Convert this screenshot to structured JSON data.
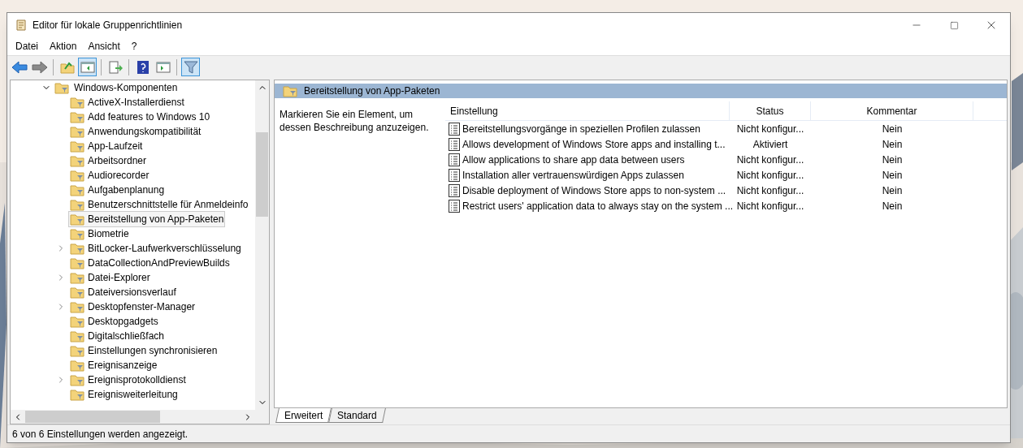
{
  "window": {
    "title": "Editor für lokale Gruppenrichtlinien"
  },
  "menu": [
    "Datei",
    "Aktion",
    "Ansicht",
    "?"
  ],
  "toolbar": [
    {
      "kind": "back",
      "pressed": false
    },
    {
      "kind": "forward",
      "pressed": false
    },
    {
      "kind": "sep"
    },
    {
      "kind": "up",
      "pressed": false
    },
    {
      "kind": "tree",
      "pressed": true
    },
    {
      "kind": "sep"
    },
    {
      "kind": "export",
      "pressed": false
    },
    {
      "kind": "sep"
    },
    {
      "kind": "help",
      "pressed": false
    },
    {
      "kind": "pane",
      "pressed": false
    },
    {
      "kind": "sep"
    },
    {
      "kind": "filter",
      "pressed": true
    }
  ],
  "tree": {
    "label": "Windows-Komponenten",
    "expanded": true,
    "children": [
      {
        "label": "ActiveX-Installerdienst",
        "expandable": false,
        "selected": false
      },
      {
        "label": "Add features to Windows 10",
        "expandable": false,
        "selected": false
      },
      {
        "label": "Anwendungskompatibilität",
        "expandable": false,
        "selected": false
      },
      {
        "label": "App-Laufzeit",
        "expandable": false,
        "selected": false
      },
      {
        "label": "Arbeitsordner",
        "expandable": false,
        "selected": false
      },
      {
        "label": "Audiorecorder",
        "expandable": false,
        "selected": false
      },
      {
        "label": "Aufgabenplanung",
        "expandable": false,
        "selected": false
      },
      {
        "label": "Benutzerschnittstelle für Anmeldeinfo",
        "expandable": false,
        "selected": false
      },
      {
        "label": "Bereitstellung von App-Paketen",
        "expandable": false,
        "selected": true
      },
      {
        "label": "Biometrie",
        "expandable": false,
        "selected": false
      },
      {
        "label": "BitLocker-Laufwerkverschlüsselung",
        "expandable": true,
        "selected": false
      },
      {
        "label": "DataCollectionAndPreviewBuilds",
        "expandable": false,
        "selected": false
      },
      {
        "label": "Datei-Explorer",
        "expandable": true,
        "selected": false
      },
      {
        "label": "Dateiversionsverlauf",
        "expandable": false,
        "selected": false
      },
      {
        "label": "Desktopfenster-Manager",
        "expandable": true,
        "selected": false
      },
      {
        "label": "Desktopgadgets",
        "expandable": false,
        "selected": false
      },
      {
        "label": "Digitalschließfach",
        "expandable": false,
        "selected": false
      },
      {
        "label": "Einstellungen synchronisieren",
        "expandable": false,
        "selected": false
      },
      {
        "label": "Ereignisanzeige",
        "expandable": false,
        "selected": false
      },
      {
        "label": "Ereignisprotokolldienst",
        "expandable": true,
        "selected": false
      },
      {
        "label": "Ereignisweiterleitung",
        "expandable": false,
        "selected": false
      }
    ]
  },
  "pane": {
    "title": "Bereitstellung von App-Paketen",
    "description": "Markieren Sie ein Element, um dessen Beschreibung anzuzeigen.",
    "columns": [
      "Einstellung",
      "Status",
      "Kommentar"
    ],
    "rows": [
      {
        "setting": "Bereitstellungsvorgänge in speziellen Profilen zulassen",
        "status": "Nicht konfigur...",
        "comment": "Nein"
      },
      {
        "setting": "Allows development of Windows Store apps and installing t...",
        "status": "Aktiviert",
        "comment": "Nein"
      },
      {
        "setting": "Allow applications to share app data between users",
        "status": "Nicht konfigur...",
        "comment": "Nein"
      },
      {
        "setting": "Installation aller vertrauenswürdigen Apps zulassen",
        "status": "Nicht konfigur...",
        "comment": "Nein"
      },
      {
        "setting": "Disable deployment of Windows Store apps to non-system ...",
        "status": "Nicht konfigur...",
        "comment": "Nein"
      },
      {
        "setting": "Restrict users' application data to always stay on the system ...",
        "status": "Nicht konfigur...",
        "comment": "Nein"
      }
    ]
  },
  "tabs": [
    {
      "label": "Erweitert",
      "selected": true
    },
    {
      "label": "Standard",
      "selected": false
    }
  ],
  "status_bar": "6 von 6 Einstellungen werden angezeigt."
}
